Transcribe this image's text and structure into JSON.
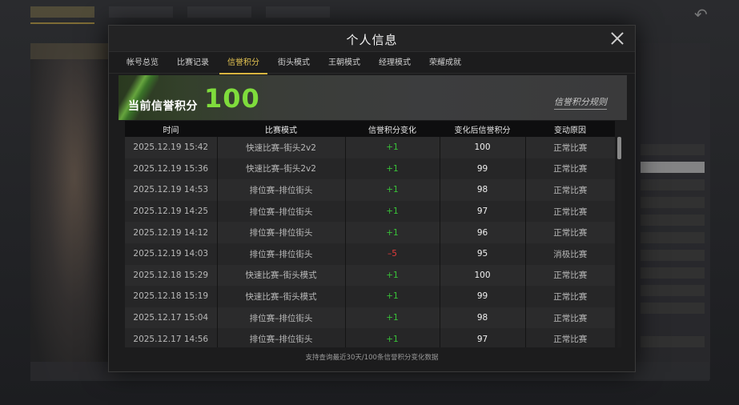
{
  "modal": {
    "title": "个人信息",
    "tabs": [
      {
        "label": "帐号总览",
        "active": false
      },
      {
        "label": "比赛记录",
        "active": false
      },
      {
        "label": "信誉积分",
        "active": true
      },
      {
        "label": "街头模式",
        "active": false
      },
      {
        "label": "王朝模式",
        "active": false
      },
      {
        "label": "经理模式",
        "active": false
      },
      {
        "label": "荣耀成就",
        "active": false
      }
    ]
  },
  "credit": {
    "label": "当前信誉积分",
    "score": "100",
    "rules_link": "信誉积分规则"
  },
  "table": {
    "headers": [
      "时间",
      "比赛模式",
      "信誉积分变化",
      "变化后信誉积分",
      "变动原因"
    ],
    "rows": [
      {
        "time": "2025.12.19  15:42",
        "mode": "快速比赛–街头2v2",
        "change": "+1",
        "after": "100",
        "reason": "正常比赛"
      },
      {
        "time": "2025.12.19  15:36",
        "mode": "快速比赛–街头2v2",
        "change": "+1",
        "after": "99",
        "reason": "正常比赛"
      },
      {
        "time": "2025.12.19  14:53",
        "mode": "排位赛–排位街头",
        "change": "+1",
        "after": "98",
        "reason": "正常比赛"
      },
      {
        "time": "2025.12.19  14:25",
        "mode": "排位赛–排位街头",
        "change": "+1",
        "after": "97",
        "reason": "正常比赛"
      },
      {
        "time": "2025.12.19  14:12",
        "mode": "排位赛–排位街头",
        "change": "+1",
        "after": "96",
        "reason": "正常比赛"
      },
      {
        "time": "2025.12.19  14:03",
        "mode": "排位赛–排位街头",
        "change": "–5",
        "after": "95",
        "reason": "消极比赛"
      },
      {
        "time": "2025.12.18  15:29",
        "mode": "快速比赛–街头模式",
        "change": "+1",
        "after": "100",
        "reason": "正常比赛"
      },
      {
        "time": "2025.12.18  15:19",
        "mode": "快速比赛–街头模式",
        "change": "+1",
        "after": "99",
        "reason": "正常比赛"
      },
      {
        "time": "2025.12.17  15:04",
        "mode": "排位赛–排位街头",
        "change": "+1",
        "after": "98",
        "reason": "正常比赛"
      },
      {
        "time": "2025.12.17  14:56",
        "mode": "排位赛–排位街头",
        "change": "+1",
        "after": "97",
        "reason": "正常比赛"
      }
    ]
  },
  "footer_note": "支持查询最近30天/100条信誉积分变化数据",
  "colors": {
    "accent_gold": "#d9b640",
    "score_green": "#7fdc3c",
    "positive": "#38c238",
    "negative": "#e33b3b"
  },
  "icons": {
    "close": "close-icon",
    "back": "back-arrow-icon"
  }
}
